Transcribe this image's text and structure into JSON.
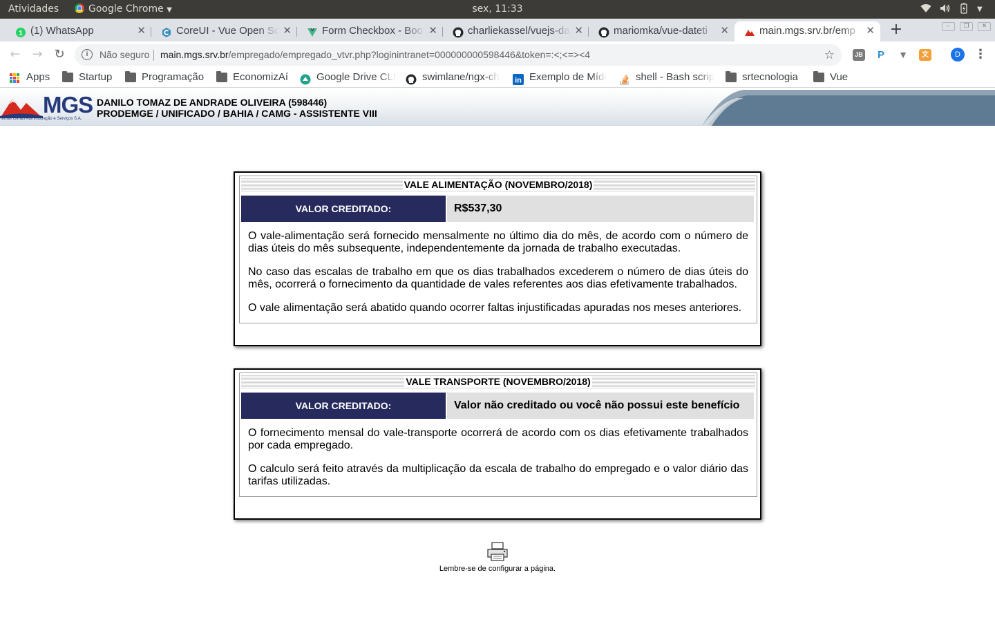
{
  "system_bar": {
    "activities": "Atividades",
    "app": "Google Chrome",
    "clock": "sex, 11:33"
  },
  "tabs": [
    {
      "label": "(1) WhatsApp",
      "icon": "whatsapp-icon"
    },
    {
      "label": "CoreUI - Vue Open So",
      "icon": "coreui-icon"
    },
    {
      "label": "Form Checkbox - Boo",
      "icon": "vue-icon"
    },
    {
      "label": "charliekassel/vuejs-da",
      "icon": "github-icon"
    },
    {
      "label": "mariomka/vue-dateti",
      "icon": "github-icon"
    },
    {
      "label": "main.mgs.srv.br/emp",
      "icon": "mgs-icon",
      "active": true
    }
  ],
  "toolbar": {
    "security_label": "Não seguro",
    "url_host": "main.mgs.srv.br",
    "url_path": "/empregado/empregado_vtvr.php?loginintranet=000000000598446&token=:<;<=><4",
    "profile_initial": "D"
  },
  "bookmarks": [
    {
      "label": "Apps",
      "icon": "apps-icon"
    },
    {
      "label": "Startup",
      "icon": "folder-icon"
    },
    {
      "label": "Programação",
      "icon": "folder-icon"
    },
    {
      "label": "EconomizAí",
      "icon": "folder-icon"
    },
    {
      "label": "Google Drive CLI",
      "icon": "drive-icon"
    },
    {
      "label": "swimlane/ngx-ch",
      "icon": "github-icon"
    },
    {
      "label": "Exemplo de Mídi",
      "icon": "linkedin-icon"
    },
    {
      "label": "shell - Bash scrip",
      "icon": "stackoverflow-icon"
    },
    {
      "label": "srtecnologia",
      "icon": "folder-icon"
    },
    {
      "label": "Vue",
      "icon": "folder-icon"
    }
  ],
  "header": {
    "logo_text": "MGS",
    "logo_tagline": "Minas Gerais Administração e Serviços S.A.",
    "employee_name": "DANILO TOMAZ DE ANDRADE OLIVEIRA (598446)",
    "employee_department": "PRODEMGE / UNIFICADO / BAHIA / CAMG - ASSISTENTE VIII"
  },
  "meal_voucher": {
    "title": "VALE ALIMENTAÇÃO (NOVEMBRO/2018)",
    "value_label": "VALOR CREDITADO:",
    "value": "R$537,30",
    "paragraphs": [
      "O vale-alimentação será fornecido mensalmente no último dia do mês, de acordo com o número de dias úteis do mês subsequente, independentemente da jornada de trabalho executadas.",
      "No caso das escalas de trabalho em que os dias trabalhados excederem o número de dias úteis do mês, ocorrerá o fornecimento da quantidade de vales referentes aos dias efetivamente trabalhados.",
      "O vale alimentação será abatido quando ocorrer faltas injustificadas apuradas nos meses anteriores."
    ]
  },
  "transport_voucher": {
    "title": "VALE TRANSPORTE (NOVEMBRO/2018)",
    "value_label": "VALOR CREDITADO:",
    "value": "Valor não creditado ou você não possui este benefício",
    "paragraphs": [
      "O fornecimento mensal do vale-transporte ocorrerá de acordo com os dias efetivamente trabalhados por cada empregado.",
      "O calculo será feito através da multiplicação da escala de trabalho do empregado e o valor diário das tarifas utilizadas."
    ]
  },
  "footer": {
    "print_icon": "printer-icon",
    "note": "Lembre-se de configurar a página."
  },
  "colors": {
    "label_bg": "#262a5c",
    "value_bg": "#e0e0e0",
    "brand_blue": "#253a7a",
    "brand_red": "#d52b1e"
  }
}
